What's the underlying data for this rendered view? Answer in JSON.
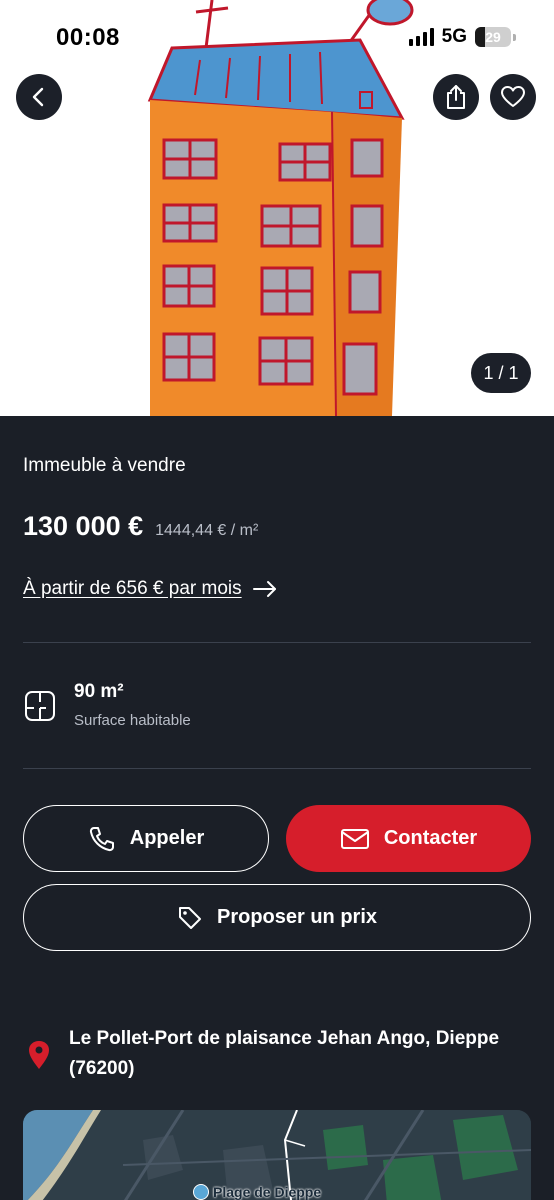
{
  "status_bar": {
    "time": "00:08",
    "network": "5G",
    "battery": "29"
  },
  "gallery": {
    "counter": "1 / 1"
  },
  "listing": {
    "type": "Immeuble à vendre",
    "price": "130 000 €",
    "price_per_m2": "1444,44 € / m²",
    "monthly": "À partir de 656 € par mois",
    "surface_value": "90 m²",
    "surface_label": "Surface habitable"
  },
  "actions": {
    "call": "Appeler",
    "contact": "Contacter",
    "offer": "Proposer un prix"
  },
  "location": {
    "address": "Le Pollet-Port de plaisance Jehan Ango, Dieppe (76200)",
    "map_label": "Plage de Dieppe"
  },
  "colors": {
    "background": "#1b1f27",
    "accent_red": "#d61e2b",
    "muted_text": "#b9bec8",
    "divider": "#3b414d"
  },
  "icons": {
    "back": "chevron-left-icon",
    "share": "share-icon",
    "favorite": "heart-icon",
    "surface": "floor-plan-icon",
    "call": "phone-icon",
    "contact": "envelope-icon",
    "offer": "tag-icon",
    "location": "map-pin-icon"
  }
}
